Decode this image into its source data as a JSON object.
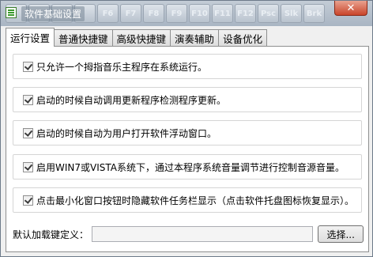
{
  "window": {
    "title": "软件基础设置",
    "close_glyph": "✕",
    "keyboard_backdrop_keys": [
      "",
      "",
      "",
      "",
      "F6",
      "F7",
      "F8",
      "F9",
      "F10",
      "F11",
      "F12",
      "Psc",
      "Slk",
      "Brk"
    ]
  },
  "tabs": [
    {
      "label": "运行设置",
      "active": true
    },
    {
      "label": "普通快捷键",
      "active": false
    },
    {
      "label": "高级快捷键",
      "active": false
    },
    {
      "label": "演奏辅助",
      "active": false
    },
    {
      "label": "设备优化",
      "active": false
    }
  ],
  "options": [
    {
      "label": "只允许一个拇指音乐主程序在系统运行。",
      "checked": true
    },
    {
      "label": "启动的时候自动调用更新程序检测程序更新。",
      "checked": true
    },
    {
      "label": "启动的时候自动为用户打开软件浮动窗口。",
      "checked": true
    },
    {
      "label": "启用WIN7或VISTA系统下，通过本程序系统音量调节进行控制音源音量。",
      "checked": true
    },
    {
      "label": "点击最小化窗口按钮时隐藏软件任务栏显示（点击软件托盘图标恢复显示）。",
      "checked": true
    }
  ],
  "hotkey": {
    "label": "默认加载键定义：",
    "value": "",
    "button_label": "选择..."
  }
}
